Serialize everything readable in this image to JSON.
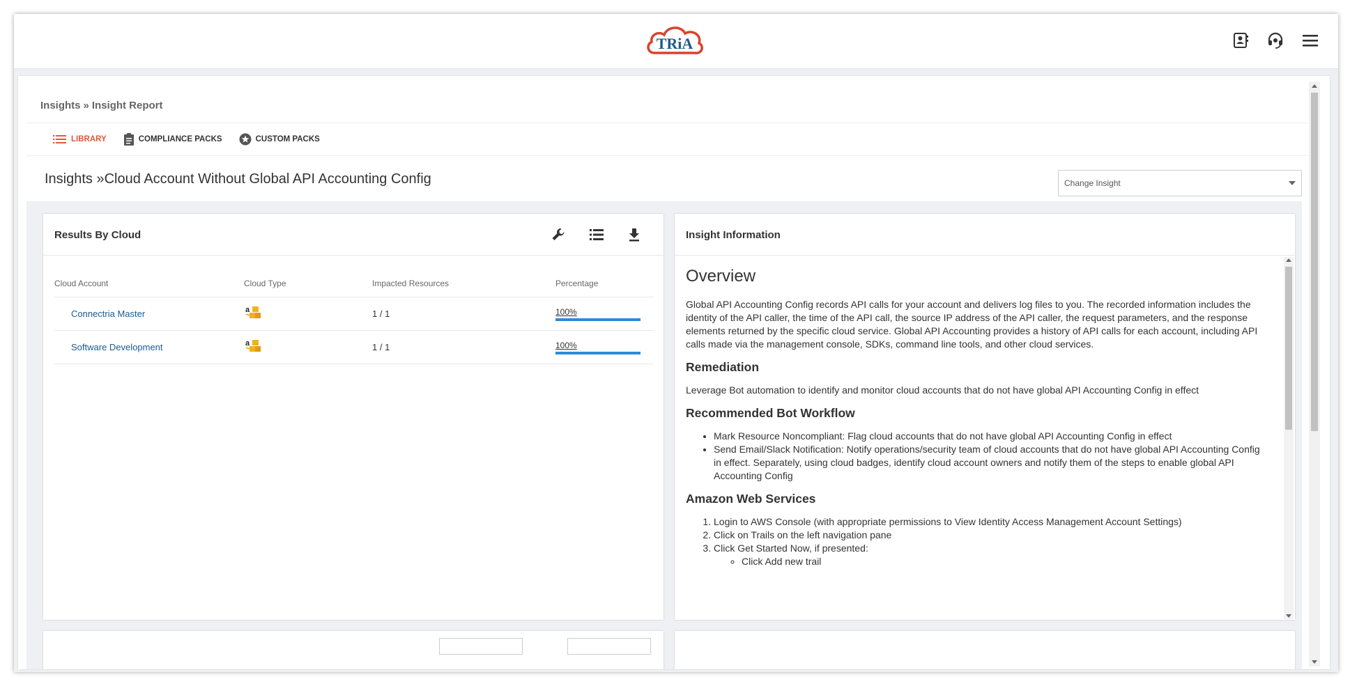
{
  "app": {
    "logo_text": "TRiA"
  },
  "header_icons": [
    {
      "name": "contacts-icon"
    },
    {
      "name": "headset-icon"
    },
    {
      "name": "hamburger-menu-icon"
    }
  ],
  "breadcrumb": {
    "root": "Insights",
    "sep": "»",
    "current": "Insight Report"
  },
  "tabs": [
    {
      "label": "LIBRARY",
      "icon": "list-icon",
      "active": true
    },
    {
      "label": "COMPLIANCE PACKS",
      "icon": "clipboard-icon",
      "active": false
    },
    {
      "label": "CUSTOM PACKS",
      "icon": "star-badge-icon",
      "active": false
    }
  ],
  "insight": {
    "title": "Insights »Cloud Account Without Global API Accounting Config",
    "change_placeholder": "Change Insight"
  },
  "results": {
    "title": "Results By Cloud",
    "tools": [
      "wrench-icon",
      "list-view-icon",
      "download-icon"
    ],
    "columns": [
      "Cloud Account",
      "Cloud Type",
      "Impacted Resources",
      "Percentage"
    ],
    "rows": [
      {
        "account": "Connectria Master",
        "cloud_type": "aws-icon",
        "impacted": "1 / 1",
        "percentage": "100%",
        "fill": 1.0
      },
      {
        "account": "Software Development",
        "cloud_type": "aws-icon",
        "impacted": "1 / 1",
        "percentage": "100%",
        "fill": 1.0
      }
    ]
  },
  "info": {
    "title": "Insight Information",
    "overview_heading": "Overview",
    "overview_text": "Global API Accounting Config records API calls for your account and delivers log files to you. The recorded information includes the identity of the API caller, the time of the API call, the source IP address of the API caller, the request parameters, and the response elements returned by the specific cloud service. Global API Accounting provides a history of API calls for each account, including API calls made via the management console, SDKs, command line tools, and other cloud services.",
    "remediation_heading": "Remediation",
    "remediation_text": "Leverage Bot automation to identify and monitor cloud accounts that do not have global API Accounting Config in effect",
    "workflow_heading": "Recommended Bot Workflow",
    "workflow_items": [
      "Mark Resource Noncompliant: Flag cloud accounts that do not have global API Accounting Config in effect",
      "Send Email/Slack Notification: Notify operations/security team of cloud accounts that do not have global API Accounting Config in effect. Separately, using cloud badges, identify cloud account owners and notify them of the steps to enable global API Accounting Config"
    ],
    "aws_heading": "Amazon Web Services",
    "aws_steps": [
      "Login to AWS Console (with appropriate permissions to View Identity Access Management Account Settings)",
      "Click on Trails on the left navigation pane",
      "Click Get Started Now, if presented:"
    ],
    "aws_substeps": [
      "Click Add new trail"
    ]
  },
  "colors": {
    "accent": "#e0583c",
    "link": "#1a5b8f",
    "bar": "#2d8bd8",
    "logo_red": "#d9432e",
    "logo_blue": "#1f5a8c"
  }
}
